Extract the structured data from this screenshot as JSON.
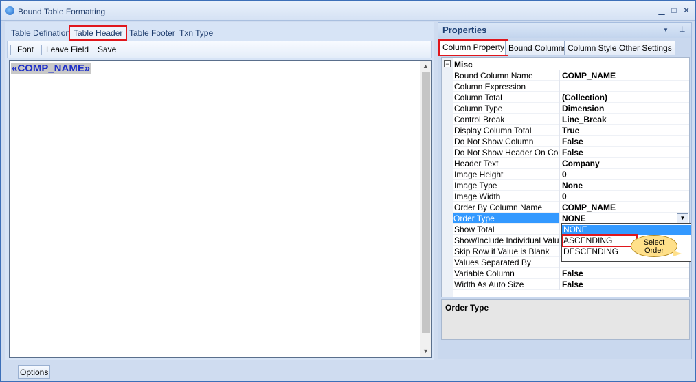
{
  "window": {
    "title": "Bound Table Formatting",
    "controls": {
      "minimize": "▁",
      "maximize": "□",
      "close": "✕"
    }
  },
  "left": {
    "tabs": [
      "Table Defination",
      "Table Header",
      "Table Footer",
      "Txn Type"
    ],
    "active_tab": "Table Header",
    "toolbar": {
      "font": "Font",
      "leave_field": "Leave Field",
      "save": "Save"
    },
    "editor": {
      "field_token": "«COMP_NAME»"
    }
  },
  "properties": {
    "title": "Properties",
    "header_icons": {
      "dropdown": "▼",
      "pin": "⊥"
    },
    "tabs": [
      "Column Property",
      "Bound Columns",
      "Column Style",
      "Other Settings"
    ],
    "active_tab": "Column Property",
    "category": {
      "toggle": "−",
      "name": "Misc"
    },
    "rows": [
      {
        "name": "Bound Column Name",
        "value": "COMP_NAME"
      },
      {
        "name": "Column Expression",
        "value": ""
      },
      {
        "name": "Column Total",
        "value": "(Collection)"
      },
      {
        "name": "Column Type",
        "value": "Dimension"
      },
      {
        "name": "Control Break",
        "value": "Line_Break"
      },
      {
        "name": "Display Column Total",
        "value": "True"
      },
      {
        "name": "Do Not Show Column",
        "value": "False"
      },
      {
        "name": "Do Not Show Header On Control Break",
        "value": "False"
      },
      {
        "name": "Header Text",
        "value": "Company"
      },
      {
        "name": "Image Height",
        "value": "0"
      },
      {
        "name": "Image Type",
        "value": "None"
      },
      {
        "name": "Image Width",
        "value": "0"
      },
      {
        "name": "Order By Column Name",
        "value": "COMP_NAME"
      },
      {
        "name": "Order Type",
        "value": "NONE"
      },
      {
        "name": "Show Total",
        "value": ""
      },
      {
        "name": "Show/Include Individual Values",
        "value": ""
      },
      {
        "name": "Skip Row if Value is Blank",
        "value": ""
      },
      {
        "name": "Values Separated By",
        "value": ""
      },
      {
        "name": "Variable Column",
        "value": "False"
      },
      {
        "name": "Width As Auto Size",
        "value": "False"
      }
    ],
    "selected_row": "Order Type",
    "dropdown_options": [
      "NONE",
      "ASCENDING",
      "DESCENDING"
    ],
    "dropdown_selected": "NONE",
    "dropdown_highlighted": "ASCENDING",
    "callout": {
      "line1": "Select",
      "line2": "Order"
    },
    "description_title": "Order Type"
  },
  "bottom": {
    "options": "Options"
  },
  "colors": {
    "accent": "#3399ff",
    "highlight_border": "#e0161c",
    "field_text": "#1e2fc8"
  }
}
